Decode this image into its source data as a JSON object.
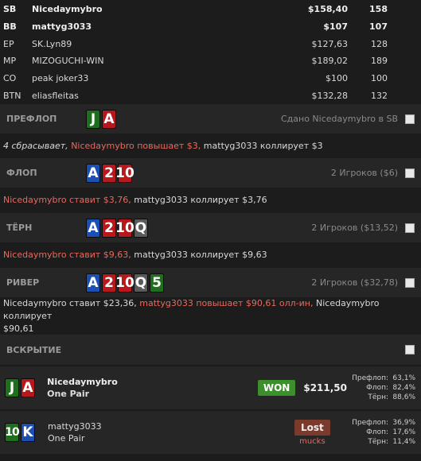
{
  "players": [
    {
      "pos": "SB",
      "name": "Nicedaymybro",
      "stack": "$158,40",
      "bb": "158",
      "bold": true
    },
    {
      "pos": "BB",
      "name": "mattyg3033",
      "stack": "$107",
      "bb": "107",
      "bold": true
    },
    {
      "pos": "EP",
      "name": "SK.Lyn89",
      "stack": "$127,63",
      "bb": "128",
      "bold": false
    },
    {
      "pos": "MP",
      "name": "MIZOGUCHI-WIN",
      "stack": "$189,02",
      "bb": "189",
      "bold": false
    },
    {
      "pos": "CO",
      "name": "peak joker33",
      "stack": "$100",
      "bb": "100",
      "bold": false
    },
    {
      "pos": "BTN",
      "name": "eliasfleitas",
      "stack": "$132,28",
      "bb": "132",
      "bold": false
    }
  ],
  "preflop": {
    "title": "ПРЕФЛОП",
    "info": "Сдано Nicedaymybro в SB",
    "cards": [
      {
        "rank": "J",
        "suit": "s"
      },
      {
        "rank": "A",
        "suit": "h"
      }
    ],
    "action": {
      "p1": "4 сбрасывает, ",
      "p2": "Nicedaymybro повышает $3,",
      "p3": " mattyg3033 коллирует $3"
    }
  },
  "flop": {
    "title": "ФЛОП",
    "info": "2 Игроков ($6)",
    "cards": [
      {
        "rank": "A",
        "suit": "d"
      },
      {
        "rank": "2",
        "suit": "h"
      },
      {
        "rank": "10",
        "suit": "h"
      }
    ],
    "action": {
      "p1": "Nicedaymybro ставит $3,76,",
      "p2": " mattyg3033 коллирует $3,76"
    }
  },
  "turn": {
    "title": "ТЁРН",
    "info": "2 Игроков ($13,52)",
    "cards": [
      {
        "rank": "A",
        "suit": "d"
      },
      {
        "rank": "2",
        "suit": "h"
      },
      {
        "rank": "10",
        "suit": "h"
      },
      {
        "rank": "Q",
        "suit": "c"
      }
    ],
    "action": {
      "p1": "Nicedaymybro ставит $9,63,",
      "p2": " mattyg3033 коллирует $9,63"
    }
  },
  "river": {
    "title": "РИВЕР",
    "info": "2 Игроков ($32,78)",
    "cards": [
      {
        "rank": "A",
        "suit": "d"
      },
      {
        "rank": "2",
        "suit": "h"
      },
      {
        "rank": "10",
        "suit": "h"
      },
      {
        "rank": "Q",
        "suit": "c"
      },
      {
        "rank": "5",
        "suit": "s"
      }
    ],
    "action": {
      "p1": "Nicedaymybro ставит $23,36, ",
      "p2": "mattyg3033 повышает $90,61 олл-ин,",
      "p3": " Nicedaymybro коллирует",
      "p4": "$90,61"
    }
  },
  "showdown": {
    "title": "ВСКРЫТИЕ",
    "rows": [
      {
        "cards": [
          {
            "rank": "J",
            "suit": "s"
          },
          {
            "rank": "A",
            "suit": "h"
          }
        ],
        "name": "Nicedaymybro",
        "hand": "One Pair",
        "result": "WON",
        "amount": "$211,50",
        "equity": [
          {
            "label": "Префлоп:",
            "value": "63,1%"
          },
          {
            "label": "Флоп:",
            "value": "82,4%"
          },
          {
            "label": "Тёрн:",
            "value": "88,6%"
          }
        ]
      },
      {
        "cards": [
          {
            "rank": "10",
            "suit": "s"
          },
          {
            "rank": "K",
            "suit": "d"
          }
        ],
        "name": "mattyg3033",
        "hand": "One Pair",
        "result": "Lost",
        "note": "mucks",
        "equity": [
          {
            "label": "Префлоп:",
            "value": "36,9%"
          },
          {
            "label": "Флоп:",
            "value": "17,6%"
          },
          {
            "label": "Тёрн:",
            "value": "11,4%"
          }
        ]
      }
    ]
  },
  "colors": {
    "spades": "#1e6e1e",
    "hearts": "#b8171b",
    "diamonds": "#1c4fb2",
    "clubs": "#5a5a5a",
    "highlight": "#e8695e"
  }
}
